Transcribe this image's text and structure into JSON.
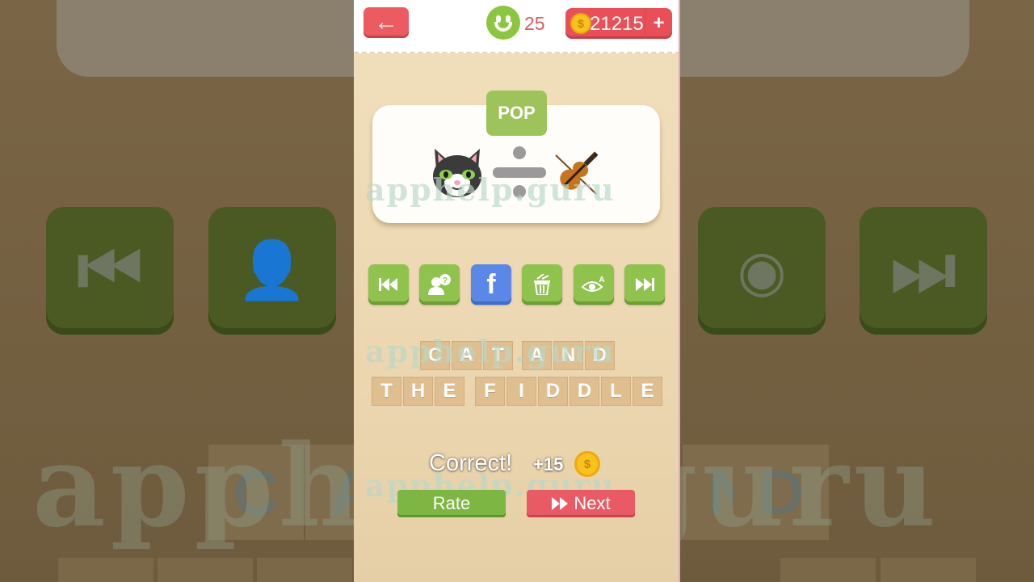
{
  "header": {
    "back_label": "←",
    "level_count": "25",
    "coin_count": "21215",
    "add_coins_label": "+"
  },
  "puzzle": {
    "category": "POP",
    "emojis": [
      "cat-face",
      "divide-sign",
      "violin"
    ]
  },
  "watermark": "apphelp.guru",
  "tools": [
    {
      "name": "previous-puzzle",
      "icon": "rewind-icon"
    },
    {
      "name": "ask-friend",
      "icon": "ask-friend-icon"
    },
    {
      "name": "facebook-share",
      "icon": "facebook-icon",
      "label": "f"
    },
    {
      "name": "remove-letters",
      "icon": "trash-icon"
    },
    {
      "name": "reveal-letter",
      "icon": "eye-reveal-icon"
    },
    {
      "name": "next-puzzle",
      "icon": "fast-forward-icon"
    }
  ],
  "answer": {
    "line1": [
      "C",
      "A",
      "T",
      "",
      "A",
      "N",
      "D"
    ],
    "line2": [
      "T",
      "H",
      "E",
      "",
      "F",
      "I",
      "D",
      "D",
      "L",
      "E"
    ]
  },
  "result": {
    "status": "Correct!",
    "reward": "+15",
    "coin_symbol": "$"
  },
  "actions": {
    "rate_label": "Rate",
    "next_label": "Next"
  },
  "colors": {
    "accent_red": "#ea5a64",
    "accent_green": "#8fc34e",
    "facebook_blue": "#5a87e8",
    "coin_gold": "#f7c21c"
  }
}
